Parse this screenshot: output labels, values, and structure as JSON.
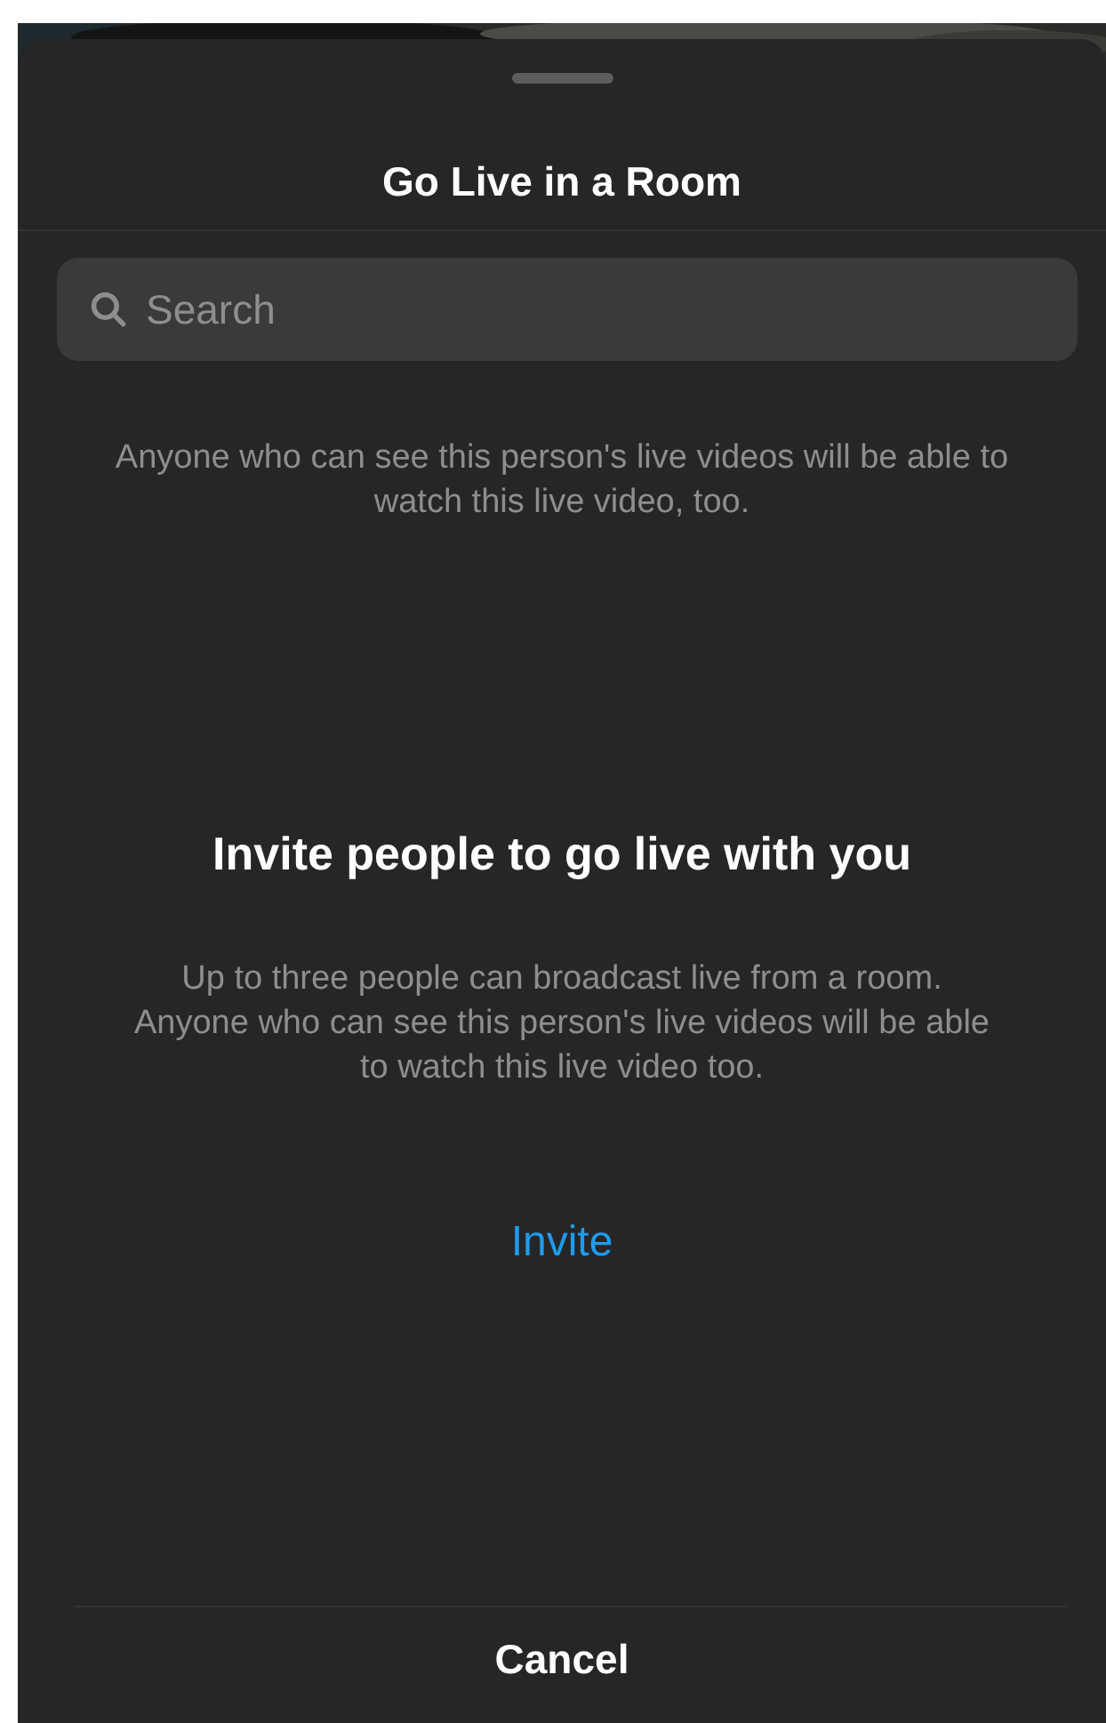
{
  "sheet": {
    "title": "Go Live in a Room"
  },
  "search": {
    "placeholder": "Search"
  },
  "notice": "Anyone who can see this person's live videos will be able to watch this live video, too.",
  "empty_state": {
    "heading": "Invite people to go live with you",
    "body": "Up to three people can broadcast live from a room. Anyone who can see this person's live videos will be able to watch this live video too.",
    "action": "Invite"
  },
  "footer": {
    "button": "Cancel"
  }
}
